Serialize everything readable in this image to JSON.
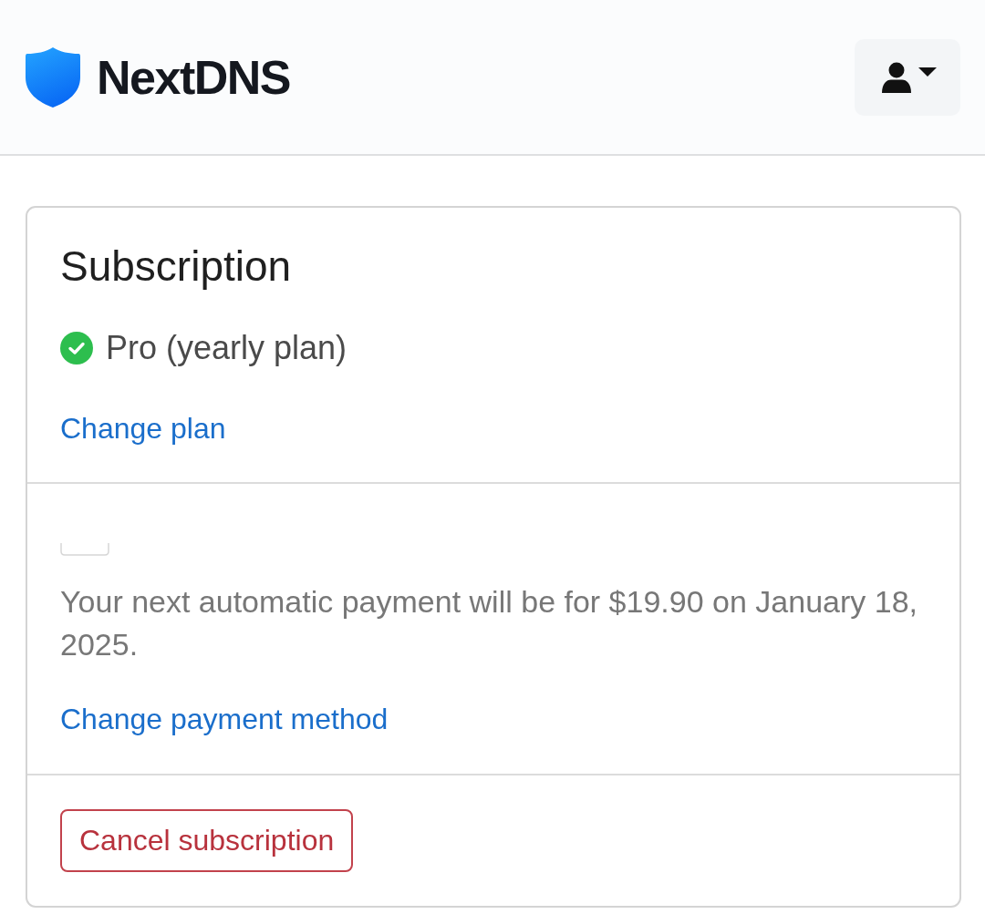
{
  "header": {
    "logo_text": "NextDNS"
  },
  "subscription": {
    "title": "Subscription",
    "plan": {
      "active": true,
      "label": "Pro (yearly plan)"
    },
    "change_plan_link": "Change plan"
  },
  "payment": {
    "next_payment_text": "Your next automatic payment will be for $19.90 on January 18, 2025.",
    "change_payment_link": "Change payment method"
  },
  "cancel_button": "Cancel subscription"
}
